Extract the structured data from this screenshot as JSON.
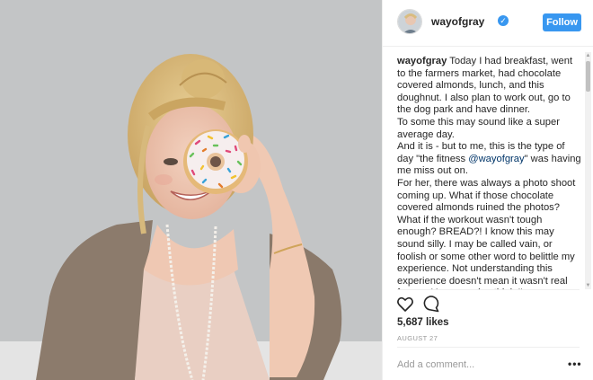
{
  "header": {
    "username": "wayofgray",
    "verified_icon": "verified-badge-icon",
    "follow_label": "Follow"
  },
  "caption": {
    "username": "wayofgray",
    "p1": "Today I had breakfast, went to the farmers market, had chocolate covered almonds, lunch, and this doughnut. I also plan to work out, go to the dog park and have dinner.",
    "p2": "To some this may sound like a super average day.",
    "p3_before": "And it is - but to me, this is the type of day \"the fitness ",
    "p3_mention": "@wayofgray",
    "p3_after": "\" was having me miss out on.",
    "p4": "For her, there was always a photo shoot coming up. What if those chocolate covered almonds ruined the photos? What if the workout wasn't tough enough? BREAD?! I know this may sound silly. I may be called vain, or foolish or some other word to belittle my experience. Not understanding this experience doesn't mean it wasn't real for me. You may also think I'm encouraging others to be unhealthy, and that's not it either."
  },
  "actions": {
    "like_icon": "heart-icon",
    "comment_icon": "comment-bubble-icon"
  },
  "likes": "5,687 likes",
  "date": "AUGUST 27",
  "comment_box": {
    "placeholder": "Add a comment...",
    "more_label": "•••"
  },
  "colors": {
    "accent": "#3897f0",
    "text": "#262626",
    "muted": "#999999",
    "mention": "#003569"
  }
}
